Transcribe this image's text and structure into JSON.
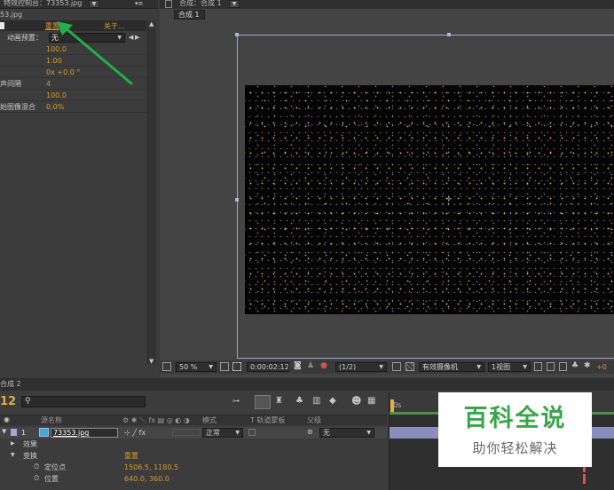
{
  "effects_panel": {
    "tab_label": "特效控制台：73353.jpg",
    "file_label": "53.jpg",
    "reset_label": "重置",
    "about_label": "关于...",
    "anim_preset_label": "动画预置：",
    "anim_preset_value": "无",
    "rows": [
      {
        "label": "",
        "value": "100.0"
      },
      {
        "label": "",
        "value": "1.00"
      },
      {
        "label": "",
        "value": "0x +0.0 °"
      },
      {
        "label": "声间隔",
        "value": "4"
      },
      {
        "label": "",
        "value": "100.0"
      },
      {
        "label": "始图像混合",
        "value": "0.0%"
      }
    ]
  },
  "comp_panel": {
    "tab_label": "合成：合成 1",
    "sub_tab": "合成 1",
    "zoom": "50 %",
    "timecode": "0:00:02:12",
    "resolution": "(1/2)",
    "camera": "有效摄像机",
    "view": "1视图",
    "exposure": "+0"
  },
  "timeline": {
    "tab_label": "合成 2",
    "current_time": "12",
    "time_marker": "0s",
    "columns": {
      "source_name": "源名称",
      "mode": "模式",
      "trkmat": "T 轨道蒙板",
      "parent": "父级"
    },
    "layer": {
      "number": "1",
      "name": "73353.jpg",
      "mode": "正常",
      "parent": "无"
    },
    "properties": [
      {
        "label": "效果",
        "value": ""
      },
      {
        "label": "变换",
        "value": "重置"
      },
      {
        "label": "定位点",
        "value": "1506.5, 1180.5"
      },
      {
        "label": "位置",
        "value": "640.0, 360.0"
      }
    ]
  },
  "watermark": {
    "title": "百科全说",
    "subtitle": "助你轻松解决"
  },
  "colors": {
    "accent_orange": "#d49a2a",
    "arrow_green": "#22b04a",
    "watermark_green": "#3aa54a"
  }
}
